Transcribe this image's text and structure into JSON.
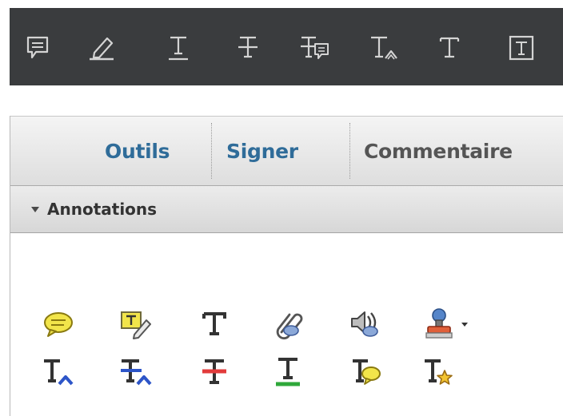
{
  "toolbar_dark": {
    "tools": [
      {
        "name": "comment-icon"
      },
      {
        "name": "highlight-pen-icon"
      },
      {
        "name": "underline-text-icon"
      },
      {
        "name": "strikethrough-text-icon"
      },
      {
        "name": "replace-text-note-icon"
      },
      {
        "name": "insert-text-icon"
      },
      {
        "name": "add-text-icon"
      },
      {
        "name": "text-box-icon"
      }
    ]
  },
  "tabs": [
    {
      "label": "Outils",
      "active": false
    },
    {
      "label": "Signer",
      "active": false
    },
    {
      "label": "Commentaire",
      "active": true
    }
  ],
  "annotations": {
    "title": "Annotations",
    "row1": [
      "sticky-note-icon",
      "highlight-text-icon",
      "add-text-icon",
      "attach-file-icon",
      "record-audio-icon",
      "stamp-icon"
    ],
    "row2": [
      "insert-text-at-cursor-icon",
      "replace-text-icon",
      "strikethrough-icon",
      "underline-icon",
      "add-note-to-text-icon",
      "add-text-star-icon"
    ]
  },
  "colors": {
    "dark_toolbar_bg": "#3a3c3e",
    "tab_link": "#2f6c99",
    "tab_active": "#555555",
    "icon_light": "#d4d4d4",
    "note_yellow": "#f2e54a",
    "blue_caret": "#2d55c8",
    "red_strike": "#e23b3b",
    "green_underline": "#2fa83a"
  }
}
